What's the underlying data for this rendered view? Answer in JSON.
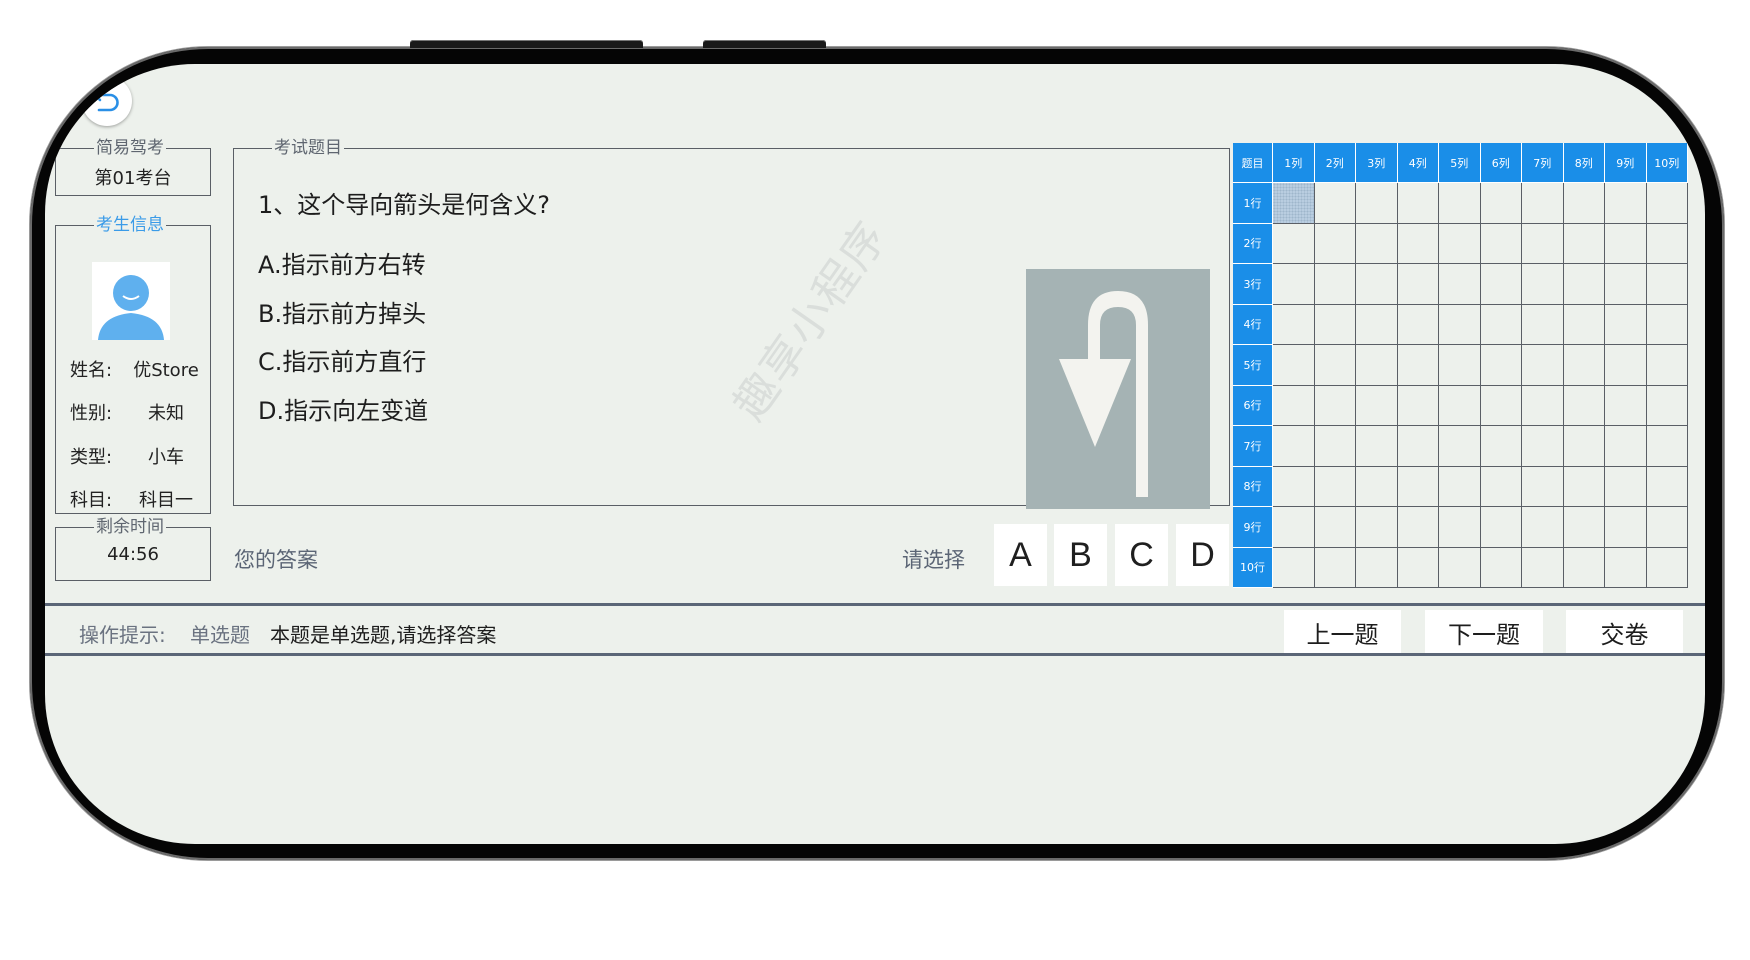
{
  "header": {
    "back_icon": "back-arrow-icon"
  },
  "exam_site": {
    "legend": "简易驾考",
    "value": "第01考台"
  },
  "student": {
    "legend": "考生信息",
    "avatar_icon": "user-avatar-icon",
    "rows": [
      {
        "label": "姓名:",
        "value": "优Store"
      },
      {
        "label": "性别:",
        "value": "未知"
      },
      {
        "label": "类型:",
        "value": "小车"
      },
      {
        "label": "科目:",
        "value": "科目一"
      }
    ]
  },
  "timer": {
    "legend": "剩余时间",
    "value": "44:56"
  },
  "question": {
    "legend": "考试题目",
    "title": "1、这个导向箭头是何含义?",
    "options": [
      "A.指示前方右转",
      "B.指示前方掉头",
      "C.指示前方直行",
      "D.指示向左变道"
    ],
    "image_icon": "u-turn-arrow-sign"
  },
  "watermark": "趣享小程序",
  "answer": {
    "label": "您的答案",
    "choose_label": "请选择",
    "choices": [
      "A",
      "B",
      "C",
      "D"
    ]
  },
  "grid": {
    "corner": "题目",
    "columns": [
      "1列",
      "2列",
      "3列",
      "4列",
      "5列",
      "6列",
      "7列",
      "8列",
      "9列",
      "10列"
    ],
    "rows": [
      "1行",
      "2行",
      "3行",
      "4行",
      "5行",
      "6行",
      "7行",
      "8行",
      "9行",
      "10行"
    ],
    "current": {
      "row": 1,
      "col": 1
    },
    "colors": {
      "header": "#1a8ee8",
      "current": "#b9cde0"
    }
  },
  "footer": {
    "tip_label": "操作提示:",
    "tip_kind": "单选题",
    "tip_text": "本题是单选题,请选择答案",
    "buttons": {
      "prev": "上一题",
      "next": "下一题",
      "submit": "交卷"
    }
  }
}
